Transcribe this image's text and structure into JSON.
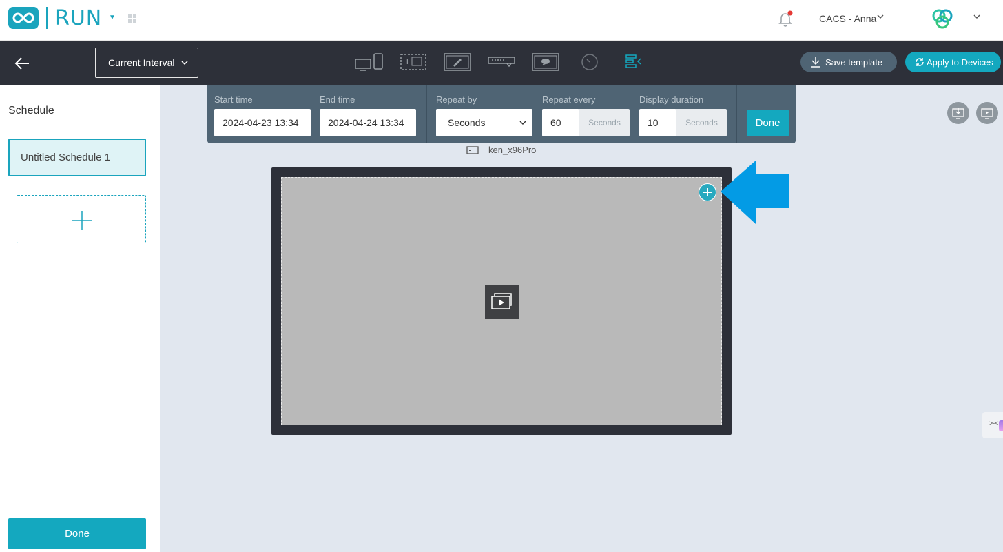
{
  "header": {
    "app_name": "RUN",
    "user_label": "CACS - Anna",
    "icons": [
      "infinity-logo-icon",
      "apps-grid-icon",
      "bell-icon",
      "org-logo-icon"
    ]
  },
  "toolbar": {
    "interval_label": "Current Interval",
    "save_template_label": "Save template",
    "apply_label": "Apply to Devices",
    "tools": [
      "screen-devices-icon",
      "text-zone-icon",
      "drawing-icon",
      "ticker-icon",
      "message-icon",
      "clock-icon",
      "schedule-align-icon"
    ]
  },
  "sidebar": {
    "title": "Schedule",
    "items": [
      {
        "label": "Untitled Schedule 1"
      }
    ],
    "done_label": "Done"
  },
  "interval": {
    "start_label": "Start time",
    "start_value": "2024-04-23 13:34",
    "end_label": "End time",
    "end_value": "2024-04-24 13:34",
    "repeat_by_label": "Repeat by",
    "repeat_by_value": "Seconds",
    "repeat_every_label": "Repeat every",
    "repeat_every_value": "60",
    "repeat_every_unit": "Seconds",
    "duration_label": "Display duration",
    "duration_value": "10",
    "duration_unit": "Seconds",
    "done_label": "Done"
  },
  "canvas": {
    "device_name": "ken_x96Pro"
  },
  "colors": {
    "accent": "#14a8bf",
    "toolbar_bg": "#2d3039",
    "panel_bg": "#4f6474",
    "workspace_bg": "#e1e7ef",
    "arrow": "#039be5"
  }
}
